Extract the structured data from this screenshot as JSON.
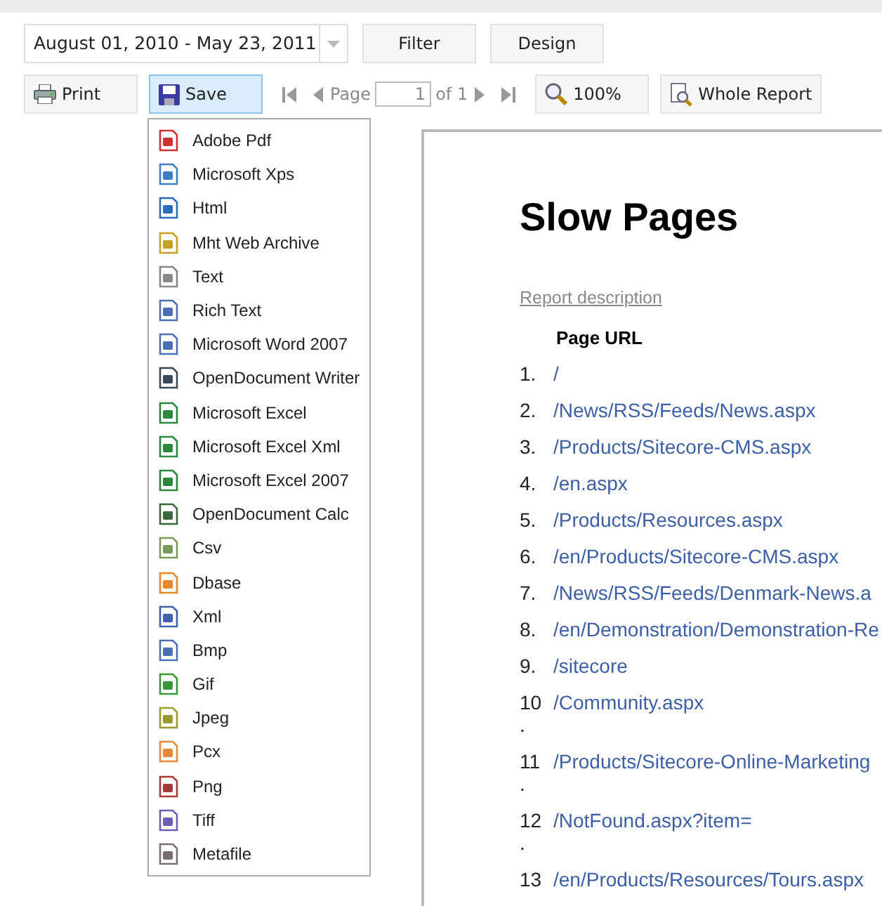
{
  "date_range": {
    "value": "August 01, 2010 - May 23, 2011"
  },
  "top_buttons": [
    "Filter",
    "Design"
  ],
  "toolbar": {
    "print": {
      "label": "Print"
    },
    "save": {
      "label": "Save",
      "expanded": true
    },
    "page_label": "Page",
    "page_value": "1",
    "page_of": "of 1",
    "zoom": {
      "label": "100%"
    },
    "whole_report": {
      "label": "Whole Report"
    }
  },
  "save_menu": [
    {
      "label": "Adobe Pdf"
    },
    {
      "label": "Microsoft Xps"
    },
    {
      "label": "Html"
    },
    {
      "label": "Mht Web Archive"
    },
    {
      "label": "Text"
    },
    {
      "label": "Rich Text"
    },
    {
      "label": "Microsoft Word 2007"
    },
    {
      "label": "OpenDocument Writer"
    },
    {
      "label": "Microsoft Excel"
    },
    {
      "label": "Microsoft Excel Xml"
    },
    {
      "label": "Microsoft Excel 2007"
    },
    {
      "label": "OpenDocument Calc"
    },
    {
      "label": "Csv"
    },
    {
      "label": "Dbase"
    },
    {
      "label": "Xml"
    },
    {
      "label": "Bmp"
    },
    {
      "label": "Gif"
    },
    {
      "label": "Jpeg"
    },
    {
      "label": "Pcx"
    },
    {
      "label": "Png"
    },
    {
      "label": "Tiff"
    },
    {
      "label": "Metafile"
    }
  ],
  "report": {
    "title": "Slow Pages",
    "description_link": "Report description",
    "column_header": "Page URL",
    "rows": [
      {
        "number": "1.",
        "url": "/"
      },
      {
        "number": "2.",
        "url": "/News/RSS/Feeds/News.aspx"
      },
      {
        "number": "3.",
        "url": "/Products/Sitecore-CMS.aspx"
      },
      {
        "number": "4.",
        "url": "/en.aspx"
      },
      {
        "number": "5.",
        "url": "/Products/Resources.aspx"
      },
      {
        "number": "6.",
        "url": "/en/Products/Sitecore-CMS.aspx"
      },
      {
        "number": "7.",
        "url": "/News/RSS/Feeds/Denmark-News.a"
      },
      {
        "number": "8.",
        "url": "/en/Demonstration/Demonstration-Re"
      },
      {
        "number": "9.",
        "url": "/sitecore"
      },
      {
        "number": "10.",
        "url": "/Community.aspx"
      },
      {
        "number": "11.",
        "url": "/Products/Sitecore-Online-Marketing"
      },
      {
        "number": "12.",
        "url": "/NotFound.aspx?item="
      },
      {
        "number": "13",
        "url": "/en/Products/Resources/Tours.aspx"
      }
    ]
  }
}
